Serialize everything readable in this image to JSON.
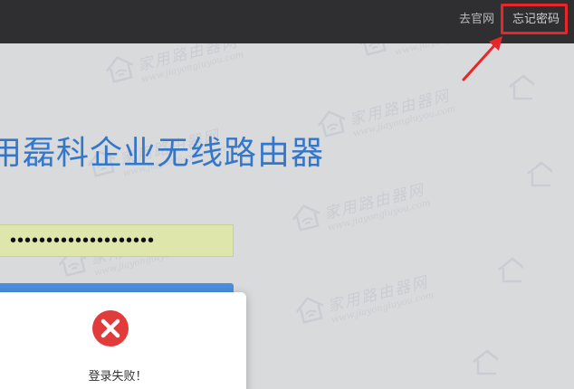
{
  "topbar": {
    "official_site_link": "去官网",
    "forgot_password_link": "忘记密码"
  },
  "main": {
    "title": "用磊科企业无线路由器",
    "password_value": "••••••••••••••••••••"
  },
  "dialog": {
    "message": "登录失败！"
  },
  "watermark": {
    "main": "家用路由器网",
    "sub": "www.jiayongluyou.com"
  },
  "colors": {
    "topbar": "#2f2f31",
    "title": "#3377cc",
    "highlight": "#e8262a",
    "password_bg": "#dfe6ab",
    "button": "#4a8ee0",
    "error": "#e23b3b"
  }
}
